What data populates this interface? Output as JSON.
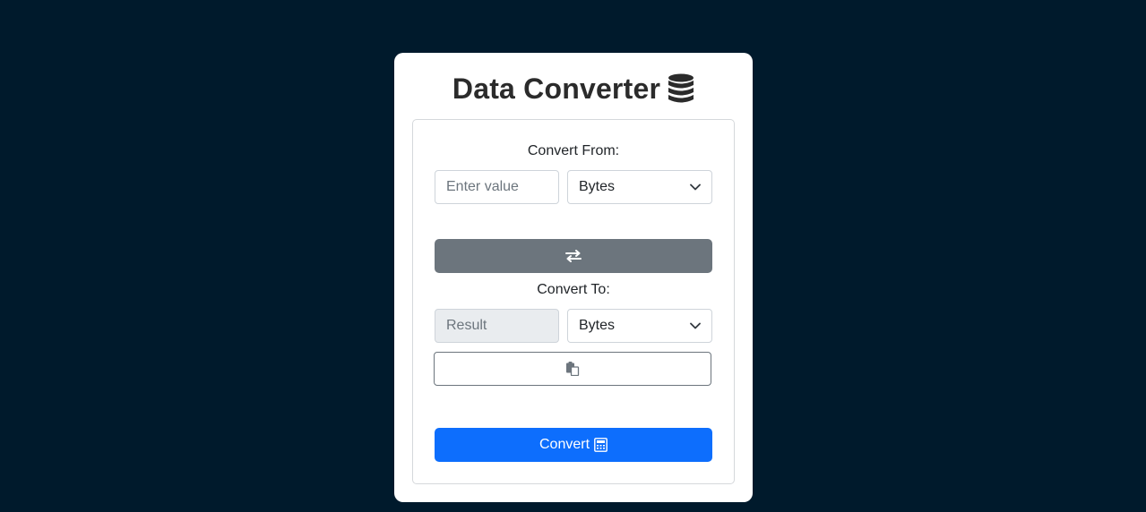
{
  "app": {
    "title": "Data Converter",
    "title_icon": "database-icon"
  },
  "from": {
    "label": "Convert From:",
    "input_placeholder": "Enter value",
    "input_value": "",
    "unit_selected": "Bytes"
  },
  "swap_button": {
    "icon": "swap-arrows-icon"
  },
  "to": {
    "label": "Convert To:",
    "result_placeholder": "Result",
    "result_value": "",
    "unit_selected": "Bytes"
  },
  "copy_button": {
    "icon": "clipboard-copy-icon"
  },
  "convert_button": {
    "label": "Convert",
    "icon": "calculator-icon"
  },
  "colors": {
    "page_background": "#001a2c",
    "card_background": "#ffffff",
    "swap_button": "#6c757d",
    "convert_button": "#0d6efd"
  }
}
